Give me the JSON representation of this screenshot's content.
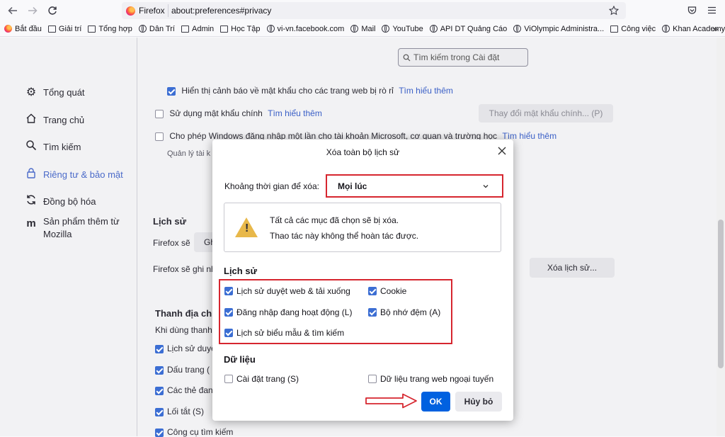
{
  "browser": {
    "tab_name": "Firefox",
    "url": "about:preferences#privacy"
  },
  "bookmarks": [
    {
      "label": "Bắt đầu",
      "icon": "firefox-icon"
    },
    {
      "label": "Giải trí",
      "icon": "folder-icon"
    },
    {
      "label": "Tổng hợp",
      "icon": "folder-icon"
    },
    {
      "label": "Dân Trí",
      "icon": "globe-icon"
    },
    {
      "label": "Admin",
      "icon": "folder-icon"
    },
    {
      "label": "Học Tập",
      "icon": "folder-icon"
    },
    {
      "label": "vi-vn.facebook.com",
      "icon": "globe-icon"
    },
    {
      "label": "Mail",
      "icon": "globe-icon"
    },
    {
      "label": "YouTube",
      "icon": "globe-icon"
    },
    {
      "label": "API DT Quảng Cáo",
      "icon": "globe-icon"
    },
    {
      "label": "ViOlympic Administra...",
      "icon": "globe-icon"
    },
    {
      "label": "Công việc",
      "icon": "folder-icon"
    },
    {
      "label": "Khan Academy",
      "icon": "globe-icon"
    }
  ],
  "sidebar": {
    "items": [
      {
        "label": "Tổng quát",
        "icon": "gear-icon"
      },
      {
        "label": "Trang chủ",
        "icon": "home-icon"
      },
      {
        "label": "Tìm kiếm",
        "icon": "search-icon"
      },
      {
        "label": "Riêng tư & bảo mật",
        "icon": "lock-icon"
      },
      {
        "label": "Đồng bộ hóa",
        "icon": "sync-icon"
      },
      {
        "label": "Sản phẩm thêm từ",
        "label2": "Mozilla",
        "icon": "mozilla-icon"
      }
    ]
  },
  "settings": {
    "search_placeholder": "Tìm kiếm trong Cài đặt",
    "breach_alert": "Hiển thị cảnh báo về mật khẩu cho các trang web bị rò rỉ",
    "learn_more": "Tìm hiểu thêm",
    "master_password": "Sử dụng mật khẩu chính",
    "change_master_password": "Thay đổi mật khẩu chính... (P)",
    "windows_sso": "Cho phép Windows đăng nhập một lần cho tài khoản Microsoft, cơ quan và trường học",
    "manage_accounts": "Quản lý tài k",
    "history_heading": "Lịch sử",
    "firefox_will": "Firefox sẽ",
    "firefox_will_value": "Gh",
    "firefox_will_record": "Firefox sẽ ghi nh",
    "clear_history_button": "Xóa lịch sử...",
    "address_bar_heading": "Thanh địa ch",
    "address_bar_desc": "Khi dùng thanh",
    "address_bar_items": [
      "Lịch sử duyệt",
      "Dấu trang (",
      "Các thẻ đan",
      "Lối tắt (S)",
      "Công cụ tìm kiếm"
    ]
  },
  "dialog": {
    "title": "Xóa toàn bộ lịch sử",
    "time_range_label": "Khoảng thời gian để xóa:",
    "time_range_value": "Mọi lúc",
    "warning_line1": "Tất cả các mục đã chọn sẽ bị xóa.",
    "warning_line2": "Thao tác này không thể hoàn tác được.",
    "history_heading": "Lịch sử",
    "history_items": [
      {
        "label": "Lịch sử duyệt web & tải xuống",
        "checked": true
      },
      {
        "label": "Cookie",
        "checked": true
      },
      {
        "label": "Đăng nhập đang hoạt động (L)",
        "checked": true
      },
      {
        "label": "Bộ nhớ đệm (A)",
        "checked": true
      },
      {
        "label": "Lịch sử biểu mẫu & tìm kiếm",
        "checked": true
      }
    ],
    "data_heading": "Dữ liệu",
    "data_items": [
      {
        "label": "Cài đặt trang (S)",
        "checked": false
      },
      {
        "label": "Dữ liệu trang web ngoại tuyến",
        "checked": false
      }
    ],
    "ok_label": "OK",
    "cancel_label": "Hủy bỏ"
  },
  "colors": {
    "annotation_red": "#d6262f",
    "primary_blue": "#0061e0",
    "checkbox_blue": "#3c6ed3"
  }
}
